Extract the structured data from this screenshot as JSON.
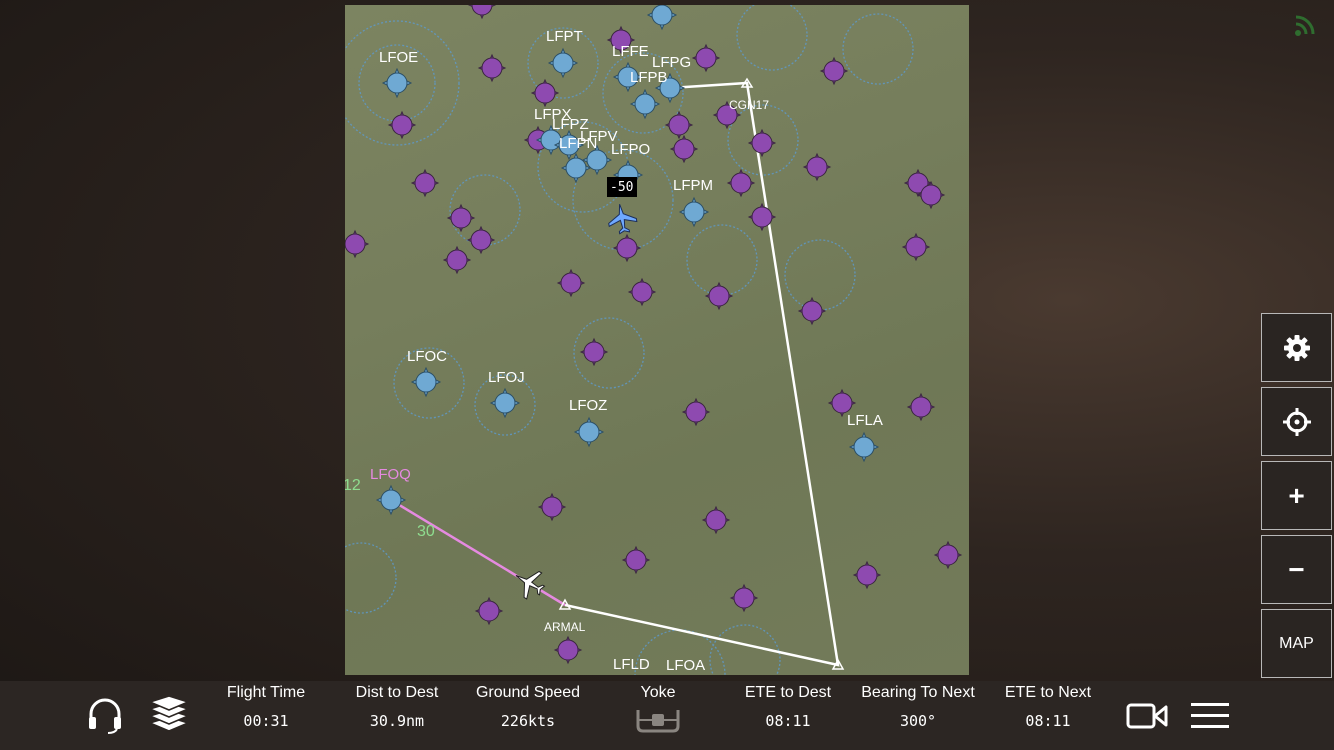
{
  "map": {
    "airports": [
      {
        "code": "LFOE"
      },
      {
        "code": "LFPT"
      },
      {
        "code": "LFFE"
      },
      {
        "code": "LFPG"
      },
      {
        "code": "LFPB"
      },
      {
        "code": "LFPX"
      },
      {
        "code": "LFPZ"
      },
      {
        "code": "LFPV"
      },
      {
        "code": "LFPN"
      },
      {
        "code": "LFPO"
      },
      {
        "code": "LFPM"
      },
      {
        "code": "LFOC"
      },
      {
        "code": "LFOJ"
      },
      {
        "code": "LFOZ"
      },
      {
        "code": "LFLA"
      },
      {
        "code": "LFOQ"
      },
      {
        "code": "LFLD"
      },
      {
        "code": "LFOA"
      }
    ],
    "waypoints": {
      "cgn": "CGN17",
      "armal": "ARMAL"
    },
    "other_traffic_altitude": "-50",
    "leg_labels": {
      "a": "12",
      "b": "30"
    },
    "colors": {
      "route": "#ffffff",
      "active_leg": "#e58ae0",
      "airport": "#6fa9d3",
      "navaid": "#8e4ab0"
    }
  },
  "right_controls": {
    "settings_icon": "gear-icon",
    "center_icon": "crosshair-icon",
    "zoom_in": "+",
    "zoom_out": "−",
    "map_label": "MAP"
  },
  "bottom_bar": {
    "flight_time": {
      "title": "Flight Time",
      "value": "00:31"
    },
    "dist_to_dest": {
      "title": "Dist to Dest",
      "value": "30.9nm"
    },
    "ground_speed": {
      "title": "Ground Speed",
      "value": "226kts"
    },
    "yoke": {
      "title": "Yoke"
    },
    "ete_to_dest": {
      "title": "ETE to Dest",
      "value": "08:11"
    },
    "bearing": {
      "title": "Bearing To Next",
      "value": "300°"
    },
    "ete_next": {
      "title": "ETE to Next",
      "value": "08:11"
    }
  }
}
